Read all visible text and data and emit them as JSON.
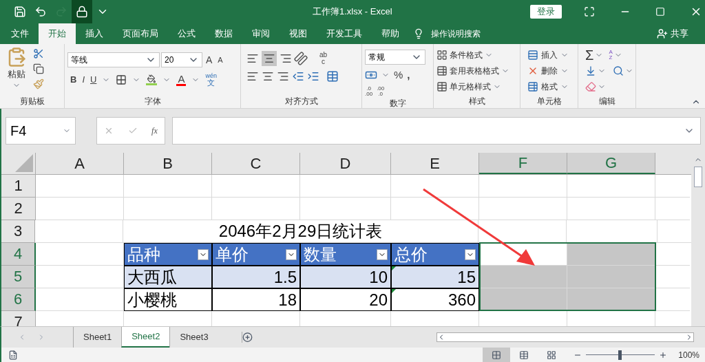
{
  "window": {
    "title": "工作簿1.xlsx  -  Excel",
    "login": "登录"
  },
  "quick_access": [
    {
      "kind": "save",
      "disabled": false
    },
    {
      "kind": "undo",
      "disabled": false
    },
    {
      "kind": "redo",
      "disabled": true
    },
    {
      "kind": "lock",
      "disabled": false
    },
    {
      "kind": "customize",
      "disabled": false
    }
  ],
  "tabs": [
    {
      "label": "文件",
      "selected": false
    },
    {
      "label": "开始",
      "selected": true
    },
    {
      "label": "插入",
      "selected": false
    },
    {
      "label": "页面布局",
      "selected": false
    },
    {
      "label": "公式",
      "selected": false
    },
    {
      "label": "数据",
      "selected": false
    },
    {
      "label": "审阅",
      "selected": false
    },
    {
      "label": "视图",
      "selected": false
    },
    {
      "label": "开发工具",
      "selected": false
    },
    {
      "label": "帮助",
      "selected": false
    }
  ],
  "search": {
    "placeholder": "操作说明搜索"
  },
  "share": "共享",
  "ribbon": {
    "clipboard": {
      "label": "剪贴板",
      "paste": "粘贴"
    },
    "font": {
      "label": "字体",
      "font_name": "等线",
      "font_size": "20",
      "grow": "A",
      "shrink": "A",
      "bold": "B",
      "italic": "I",
      "underline": "U",
      "font_color": "A",
      "phonetic": [
        "wén",
        "文"
      ]
    },
    "alignment": {
      "label": "对齐方式",
      "middle_align_selected": true,
      "wrap": [
        "ab",
        "c"
      ]
    },
    "number": {
      "label": "数字",
      "format": "常规",
      "percent": "%",
      "comma": ",",
      "increase_decimal": [
        ".0",
        ".00"
      ],
      "decrease_decimal": [
        ".00",
        ".0"
      ]
    },
    "styles": {
      "label": "样式",
      "items": [
        "条件格式",
        "套用表格格式",
        "单元格样式"
      ]
    },
    "cells": {
      "label": "单元格",
      "items": [
        "插入",
        "删除",
        "格式"
      ]
    },
    "editing": {
      "label": "编辑",
      "sum": "Σ",
      "sort": [
        "A",
        "Z"
      ]
    }
  },
  "formula_bar": {
    "name_box": "F4",
    "fx": "fx"
  },
  "columns": [
    {
      "label": "A",
      "selected": false
    },
    {
      "label": "B",
      "selected": false
    },
    {
      "label": "C",
      "selected": false
    },
    {
      "label": "D",
      "selected": false
    },
    {
      "label": "E",
      "selected": false
    },
    {
      "label": "F",
      "selected": true
    },
    {
      "label": "G",
      "selected": true
    }
  ],
  "rows": [
    {
      "label": "1",
      "selected": false,
      "cells": [
        {
          "kind": "plain"
        },
        {
          "kind": "plain"
        },
        {
          "kind": "plain"
        },
        {
          "kind": "plain"
        },
        {
          "kind": "plain"
        },
        {
          "kind": "plain"
        },
        {
          "kind": "plain"
        }
      ]
    },
    {
      "label": "2",
      "selected": false,
      "cells": [
        {
          "kind": "plain"
        },
        {
          "kind": "plain"
        },
        {
          "kind": "plain"
        },
        {
          "kind": "plain"
        },
        {
          "kind": "plain"
        },
        {
          "kind": "plain"
        },
        {
          "kind": "plain"
        }
      ]
    },
    {
      "label": "3",
      "selected": false,
      "cells": [
        {
          "kind": "plain"
        },
        {
          "kind": "title",
          "text": "2046年2月29日统计表"
        },
        {
          "kind": "plain"
        },
        {
          "kind": "plain"
        }
      ]
    },
    {
      "label": "4",
      "selected": true,
      "cells": [
        {
          "kind": "plain"
        },
        {
          "kind": "head",
          "text": "品种"
        },
        {
          "kind": "head",
          "text": "单价"
        },
        {
          "kind": "head",
          "text": "数量"
        },
        {
          "kind": "head",
          "text": "总价"
        },
        {
          "kind": "active"
        },
        {
          "kind": "range"
        }
      ]
    },
    {
      "label": "5",
      "selected": true,
      "cells": [
        {
          "kind": "plain"
        },
        {
          "kind": "band",
          "text": "大西瓜"
        },
        {
          "kind": "band",
          "text": "1.5",
          "numeric": true
        },
        {
          "kind": "band",
          "text": "10",
          "numeric": true
        },
        {
          "kind": "band",
          "text": "15",
          "numeric": true,
          "error_flag": true
        },
        {
          "kind": "range"
        },
        {
          "kind": "range"
        }
      ]
    },
    {
      "label": "6",
      "selected": true,
      "cells": [
        {
          "kind": "plain"
        },
        {
          "kind": "row",
          "text": "小樱桃"
        },
        {
          "kind": "row",
          "text": "18",
          "numeric": true
        },
        {
          "kind": "row",
          "text": "20",
          "numeric": true
        },
        {
          "kind": "row",
          "text": "360",
          "numeric": true,
          "error_flag": true
        },
        {
          "kind": "range"
        },
        {
          "kind": "range"
        }
      ]
    },
    {
      "label": "7",
      "selected": false,
      "cells": [
        {
          "kind": "plain"
        },
        {
          "kind": "plain"
        },
        {
          "kind": "plain"
        },
        {
          "kind": "plain"
        },
        {
          "kind": "plain"
        },
        {
          "kind": "plain"
        },
        {
          "kind": "plain"
        }
      ]
    }
  ],
  "sheets": [
    {
      "label": "Sheet1",
      "selected": false
    },
    {
      "label": "Sheet2",
      "selected": true
    },
    {
      "label": "Sheet3",
      "selected": false
    }
  ],
  "status_bar": {
    "views": [
      {
        "kind": "normal",
        "selected": true
      },
      {
        "kind": "page-layout",
        "selected": false
      },
      {
        "kind": "page-break",
        "selected": false
      }
    ],
    "zoom": {
      "level": 0.5,
      "reading": "100%"
    }
  }
}
